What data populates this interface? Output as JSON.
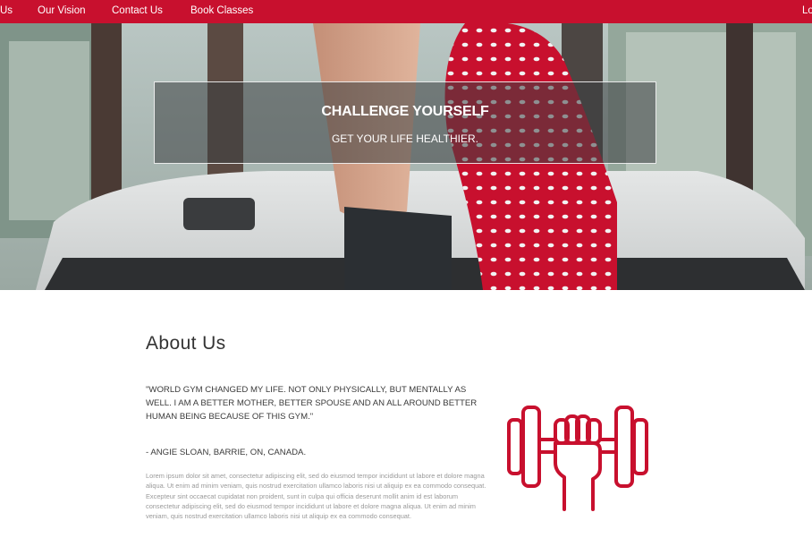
{
  "nav": {
    "items": [
      "Us",
      "Our Vision",
      "Contact Us",
      "Book Classes"
    ],
    "right_item": "Lo",
    "bg_color": "#c8102e"
  },
  "hero": {
    "title": "CHALLENGE YOURSELF",
    "subtitle": "GET YOUR LIFE HEALTHIER."
  },
  "about": {
    "heading": "About Us",
    "quote": "\"WORLD GYM CHANGED MY LIFE. NOT ONLY PHYSICALLY, BUT MENTALLY AS WELL. I AM A BETTER MOTHER, BETTER SPOUSE AND AN ALL AROUND BETTER HUMAN BEING BECAUSE OF THIS GYM.\"",
    "author": "- ANGIE SLOAN, BARRIE, ON, CANADA.",
    "body": "Lorem ipsum dolor sit amet, consectetur adipiscing elit, sed do eiusmod tempor incididunt ut labore et dolore magna aliqua. Ut enim ad minim veniam, quis nostrud exercitation ullamco laboris nisi ut aliquip ex ea commodo consequat. Excepteur sint occaecat cupidatat non proident, sunt in culpa qui officia deserunt mollit anim id est laborum consectetur adipiscing elit, sed do eiusmod tempor incididunt ut labore et dolore magna aliqua. Ut enim ad minim veniam, quis nostrud exercitation ullamco laboris nisi ut aliquip ex ea commodo consequat.",
    "icon": "dumbbell-fist-icon",
    "icon_color": "#c8102e"
  }
}
